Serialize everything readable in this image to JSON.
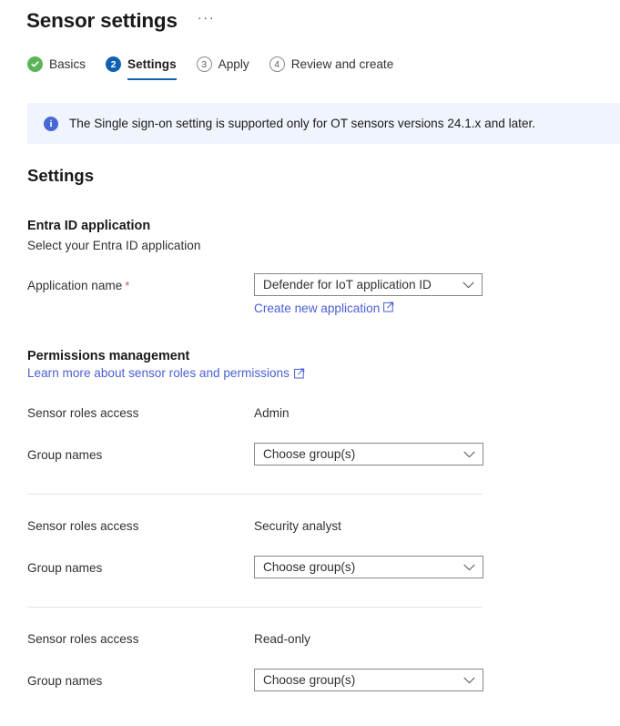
{
  "header": {
    "title": "Sensor settings",
    "more_label": "···"
  },
  "wizard": {
    "steps": [
      {
        "marker": "check",
        "label": "Basics",
        "state": "done"
      },
      {
        "marker": "2",
        "label": "Settings",
        "state": "current"
      },
      {
        "marker": "3",
        "label": "Apply",
        "state": "pending"
      },
      {
        "marker": "4",
        "label": "Review and create",
        "state": "pending"
      }
    ]
  },
  "banner": {
    "icon": "info-icon",
    "glyph": "i",
    "text": "The Single sign-on setting is supported only for OT sensors versions 24.1.x and later."
  },
  "main": {
    "section_title": "Settings",
    "entra": {
      "heading": "Entra ID application",
      "subtitle": "Select your Entra ID application",
      "app_name_label": "Application name",
      "required_mark": "*",
      "app_name_value": "Defender for IoT application ID",
      "create_link": "Create new application"
    },
    "permissions": {
      "heading": "Permissions management",
      "learn_more_link": "Learn more about sensor roles and permissions",
      "role_label": "Sensor roles access",
      "group_label": "Group names",
      "group_placeholder": "Choose group(s)",
      "roles": [
        {
          "name": "Admin",
          "groups": "Choose group(s)"
        },
        {
          "name": "Security analyst",
          "groups": "Choose group(s)"
        },
        {
          "name": "Read-only",
          "groups": "Choose group(s)"
        }
      ]
    }
  },
  "colors": {
    "accent": "#0f62b1",
    "link": "#4a5fd4",
    "success": "#5ab55a",
    "banner_bg": "#eff4fd",
    "required": "#e04b4b"
  }
}
